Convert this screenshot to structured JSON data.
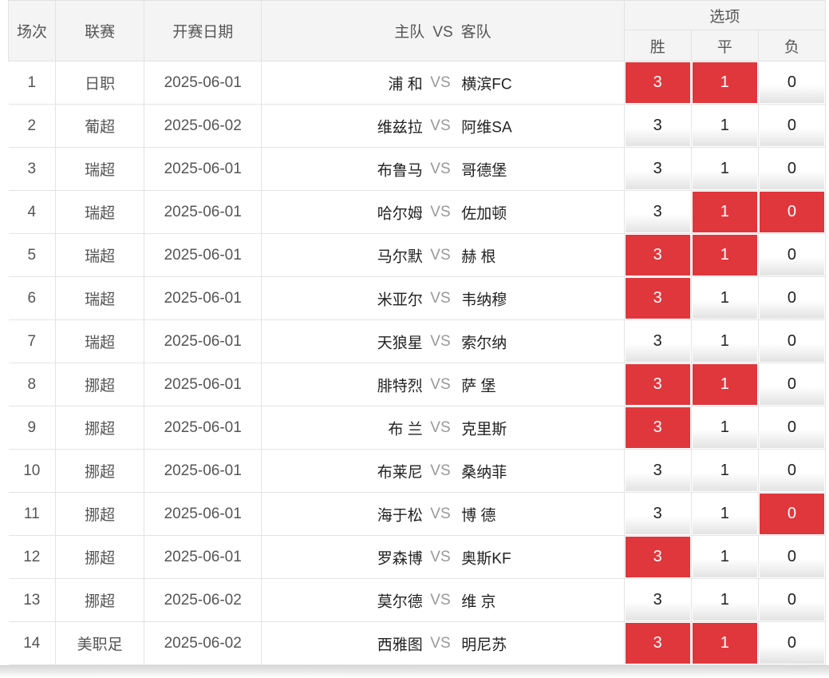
{
  "header": {
    "col_no": "场次",
    "col_league": "联赛",
    "col_date": "开赛日期",
    "col_home": "主队",
    "col_vs": "VS",
    "col_away": "客队",
    "col_options": "选项",
    "opt_win": "胜",
    "opt_draw": "平",
    "opt_lose": "负"
  },
  "accent_color": "#e0373d",
  "rows": [
    {
      "no": "1",
      "league": "日职",
      "date": "2025-06-01",
      "home": "浦 和",
      "vs": "VS",
      "away": "横滨FC",
      "w": "3",
      "d": "1",
      "l": "0",
      "w_sel": true,
      "d_sel": true,
      "l_sel": false
    },
    {
      "no": "2",
      "league": "葡超",
      "date": "2025-06-02",
      "home": "维兹拉",
      "vs": "VS",
      "away": "阿维SA",
      "w": "3",
      "d": "1",
      "l": "0",
      "w_sel": false,
      "d_sel": false,
      "l_sel": false
    },
    {
      "no": "3",
      "league": "瑞超",
      "date": "2025-06-01",
      "home": "布鲁马",
      "vs": "VS",
      "away": "哥德堡",
      "w": "3",
      "d": "1",
      "l": "0",
      "w_sel": false,
      "d_sel": false,
      "l_sel": false
    },
    {
      "no": "4",
      "league": "瑞超",
      "date": "2025-06-01",
      "home": "哈尔姆",
      "vs": "VS",
      "away": "佐加顿",
      "w": "3",
      "d": "1",
      "l": "0",
      "w_sel": false,
      "d_sel": true,
      "l_sel": true
    },
    {
      "no": "5",
      "league": "瑞超",
      "date": "2025-06-01",
      "home": "马尔默",
      "vs": "VS",
      "away": "赫 根",
      "w": "3",
      "d": "1",
      "l": "0",
      "w_sel": true,
      "d_sel": true,
      "l_sel": false
    },
    {
      "no": "6",
      "league": "瑞超",
      "date": "2025-06-01",
      "home": "米亚尔",
      "vs": "VS",
      "away": "韦纳穆",
      "w": "3",
      "d": "1",
      "l": "0",
      "w_sel": true,
      "d_sel": false,
      "l_sel": false
    },
    {
      "no": "7",
      "league": "瑞超",
      "date": "2025-06-01",
      "home": "天狼星",
      "vs": "VS",
      "away": "索尔纳",
      "w": "3",
      "d": "1",
      "l": "0",
      "w_sel": false,
      "d_sel": false,
      "l_sel": false
    },
    {
      "no": "8",
      "league": "挪超",
      "date": "2025-06-01",
      "home": "腓特烈",
      "vs": "VS",
      "away": "萨 堡",
      "w": "3",
      "d": "1",
      "l": "0",
      "w_sel": true,
      "d_sel": true,
      "l_sel": false
    },
    {
      "no": "9",
      "league": "挪超",
      "date": "2025-06-01",
      "home": "布 兰",
      "vs": "VS",
      "away": "克里斯",
      "w": "3",
      "d": "1",
      "l": "0",
      "w_sel": true,
      "d_sel": false,
      "l_sel": false
    },
    {
      "no": "10",
      "league": "挪超",
      "date": "2025-06-01",
      "home": "布莱尼",
      "vs": "VS",
      "away": "桑纳菲",
      "w": "3",
      "d": "1",
      "l": "0",
      "w_sel": false,
      "d_sel": false,
      "l_sel": false
    },
    {
      "no": "11",
      "league": "挪超",
      "date": "2025-06-01",
      "home": "海于松",
      "vs": "VS",
      "away": "博 德",
      "w": "3",
      "d": "1",
      "l": "0",
      "w_sel": false,
      "d_sel": false,
      "l_sel": true
    },
    {
      "no": "12",
      "league": "挪超",
      "date": "2025-06-01",
      "home": "罗森博",
      "vs": "VS",
      "away": "奥斯KF",
      "w": "3",
      "d": "1",
      "l": "0",
      "w_sel": true,
      "d_sel": false,
      "l_sel": false
    },
    {
      "no": "13",
      "league": "挪超",
      "date": "2025-06-02",
      "home": "莫尔德",
      "vs": "VS",
      "away": "维 京",
      "w": "3",
      "d": "1",
      "l": "0",
      "w_sel": false,
      "d_sel": false,
      "l_sel": false
    },
    {
      "no": "14",
      "league": "美职足",
      "date": "2025-06-02",
      "home": "西雅图",
      "vs": "VS",
      "away": "明尼苏",
      "w": "3",
      "d": "1",
      "l": "0",
      "w_sel": true,
      "d_sel": true,
      "l_sel": false
    }
  ]
}
